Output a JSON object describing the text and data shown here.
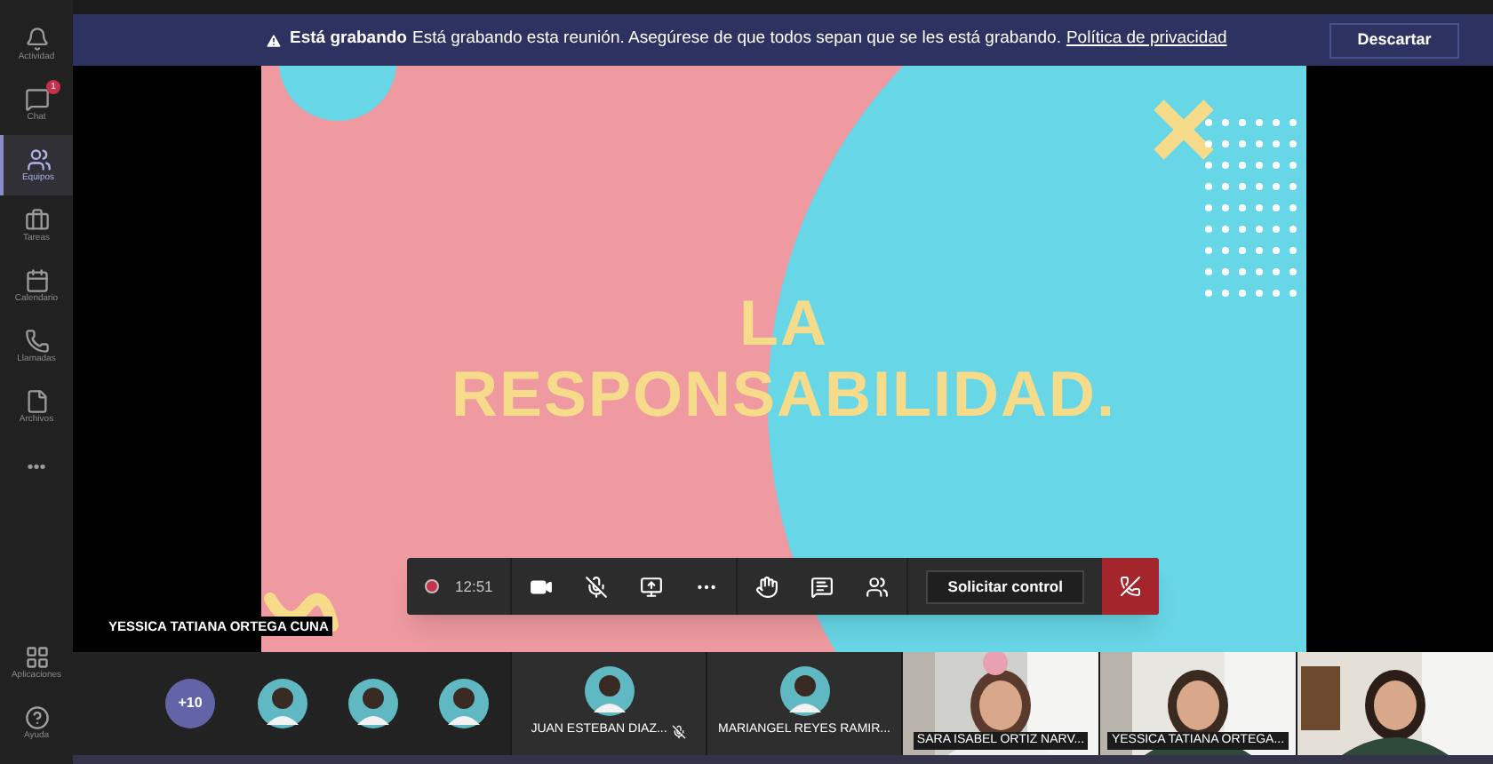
{
  "sidebar": {
    "items": [
      {
        "label": "Actividad",
        "selected": false
      },
      {
        "label": "Chat",
        "selected": false,
        "badge": "1"
      },
      {
        "label": "Equipos",
        "selected": true
      },
      {
        "label": "Tareas",
        "selected": false
      },
      {
        "label": "Calendario",
        "selected": false
      },
      {
        "label": "Llamadas",
        "selected": false
      },
      {
        "label": "Archivos",
        "selected": false
      },
      {
        "label": "•••",
        "selected": false
      }
    ],
    "bottom_items": [
      {
        "label": "Aplicaciones"
      },
      {
        "label": "Ayuda"
      }
    ]
  },
  "banner": {
    "title": "Está grabando",
    "message": "Está grabando esta reunión. Asegúrese de que todos sepan que se les está grabando.",
    "link": "Política de privacidad",
    "button": "Descartar"
  },
  "slide": {
    "lines": [
      "LA",
      "RESPONSABILIDAD."
    ]
  },
  "presenter_name": "YESSICA TATIANA ORTEGA CUNA",
  "call_controls": {
    "recording": true,
    "time": "12:51",
    "button": "Solicitar control"
  },
  "participants": {
    "overflow": "+10",
    "tiles": [
      {
        "kind": "avatar"
      },
      {
        "kind": "avatar"
      },
      {
        "kind": "avatar"
      },
      {
        "kind": "named",
        "name": "JUAN ESTEBAN DIAZ...",
        "muted": true
      },
      {
        "kind": "named",
        "name": "MARIANGEL REYES RAMIR...",
        "muted": false
      },
      {
        "kind": "video",
        "name": "SARA ISABEL ORTIZ NARV..."
      },
      {
        "kind": "video",
        "name": "YESSICA TATIANA ORTEGA..."
      },
      {
        "kind": "video"
      }
    ]
  }
}
